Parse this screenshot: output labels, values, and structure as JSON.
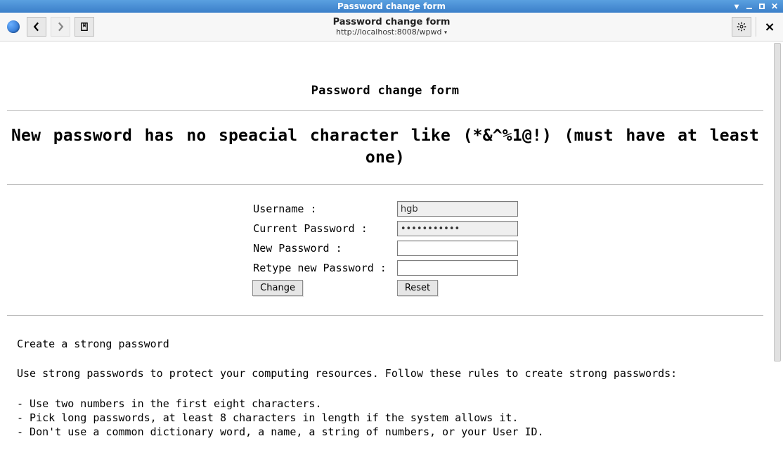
{
  "window": {
    "title": "Password change form"
  },
  "toolbar": {
    "page_title": "Password change form",
    "url": "http://localhost:8008/wpwd",
    "url_dropdown_glyph": "▾"
  },
  "page": {
    "heading": "Password change form",
    "error": "New password has no speacial character like (*&^%1@!) (must have at least one)",
    "labels": {
      "username": "Username :",
      "current_password": "Current Password :",
      "new_password": "New Password :",
      "retype_password": "Retype new Password :"
    },
    "values": {
      "username": "hgb",
      "current_password": "•••••••••••",
      "new_password": "",
      "retype_password": ""
    },
    "buttons": {
      "change": "Change",
      "reset": "Reset"
    },
    "help": {
      "title": "Create a strong password",
      "intro": "Use strong passwords to protect your computing resources. Follow these rules to create strong passwords:",
      "rules": [
        "- Use two numbers in the first eight characters.",
        "- Pick long passwords, at least 8 characters in length if the system allows it.",
        "- Don't use a common dictionary word, a name, a string of numbers, or your User ID."
      ]
    }
  }
}
